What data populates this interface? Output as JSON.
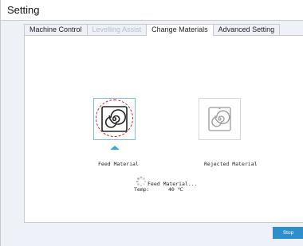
{
  "window": {
    "title": "Setting"
  },
  "tabs": [
    {
      "label": "Machine Control",
      "state": "normal"
    },
    {
      "label": "Levelling Assist",
      "state": "disabled"
    },
    {
      "label": "Change Materials",
      "state": "active"
    },
    {
      "label": "Advanced Setting",
      "state": "normal"
    }
  ],
  "materials": {
    "feed": {
      "label": "Feed Material",
      "icon": "spiral-coil-icon",
      "selected": true
    },
    "reject": {
      "label": "Rejected Material",
      "icon": "spiral-coil-icon",
      "selected": false
    }
  },
  "status": {
    "message": "Feed Material...",
    "temp_label": "Temp:",
    "temp_value": "40 ℃"
  },
  "actions": {
    "stop_label": "Stop"
  },
  "colors": {
    "accent": "#2a8fcb",
    "selection_border": "#79c0e0",
    "highlight_circle": "#c0262c",
    "panel_bg": "#eef1f8"
  }
}
